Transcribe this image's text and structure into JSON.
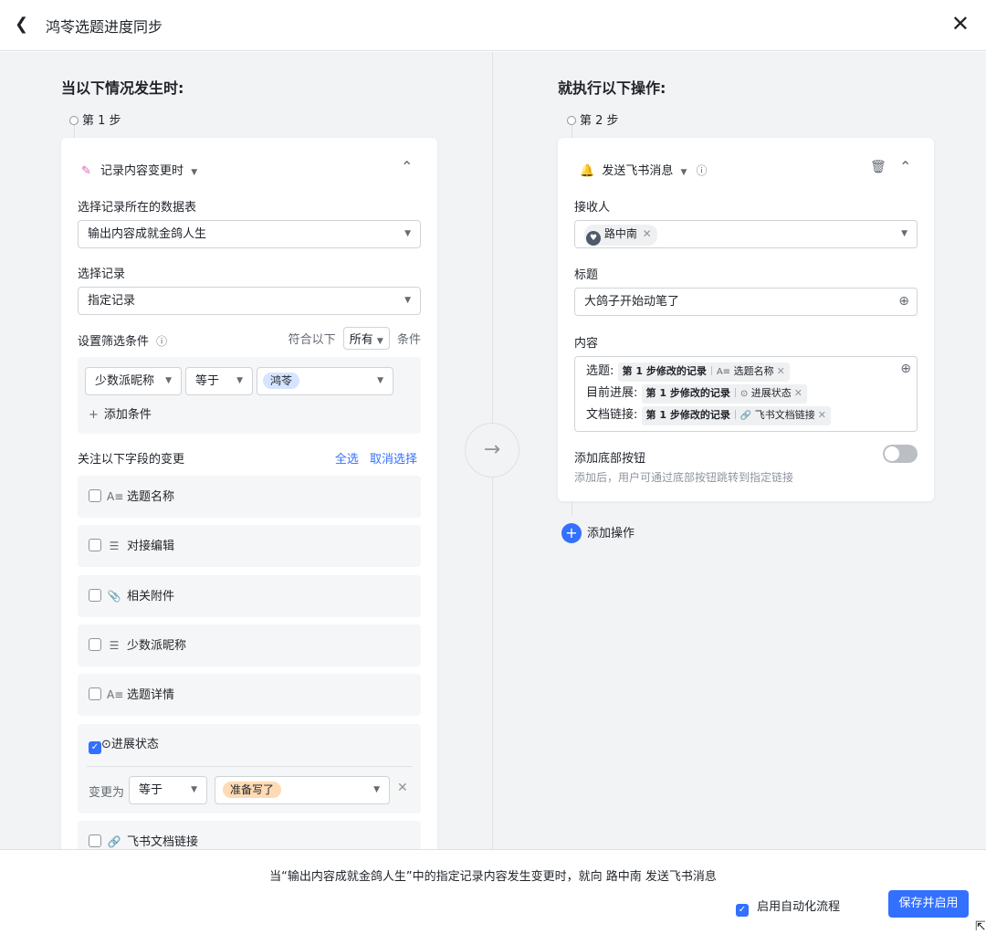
{
  "header": {
    "title": "鸿苓选题进度同步"
  },
  "left": {
    "heading": "当以下情况发生时:",
    "step": "第 1 步",
    "trigger": "记录内容变更时",
    "table_label": "选择记录所在的数据表",
    "table_value": "输出内容成就金鸽人生",
    "record_label": "选择记录",
    "record_value": "指定记录",
    "filter_label": "设置筛选条件",
    "match_prefix": "符合以下",
    "match_value": "所有",
    "match_suffix": "条件",
    "cond_field": "少数派昵称",
    "cond_op": "等于",
    "cond_value": "鸿苓",
    "add_cond": "添加条件",
    "watch_label": "关注以下字段的变更",
    "select_all": "全选",
    "deselect": "取消选择",
    "fields": [
      {
        "label": "选题名称",
        "icon": "text-field-icon",
        "checked": false
      },
      {
        "label": "对接编辑",
        "icon": "list-field-icon",
        "checked": false
      },
      {
        "label": "相关附件",
        "icon": "attachment-icon",
        "checked": false
      },
      {
        "label": "少数派昵称",
        "icon": "list-field-icon",
        "checked": false
      },
      {
        "label": "选题详情",
        "icon": "text-field-icon",
        "checked": false
      },
      {
        "label": "进展状态",
        "icon": "single-select-icon",
        "checked": true
      },
      {
        "label": "飞书文档链接",
        "icon": "link-icon",
        "checked": false
      }
    ],
    "change_to": "变更为",
    "change_op": "等于",
    "change_value": "准备写了"
  },
  "right": {
    "heading": "就执行以下操作:",
    "step": "第 2 步",
    "action": "发送飞书消息",
    "receiver_label": "接收人",
    "receiver": "路中南",
    "title_label": "标题",
    "title_value": "大鸽子开始动笔了",
    "content_label": "内容",
    "content_rows": [
      {
        "prefix": "选题:",
        "source": "第 1 步修改的记录",
        "field": "选题名称"
      },
      {
        "prefix": "目前进展:",
        "source": "第 1 步修改的记录",
        "field": "进展状态"
      },
      {
        "prefix": "文档链接:",
        "source": "第 1 步修改的记录",
        "field": "飞书文档链接"
      }
    ],
    "button_label": "添加底部按钮",
    "button_hint": "添加后，用户可通过底部按钮跳转到指定链接",
    "add_action": "添加操作"
  },
  "footer": {
    "summary": "当“输出内容成就金鸽人生”中的指定记录内容发生变更时，就向 路中南 发送飞书消息",
    "enable_label": "启用自动化流程",
    "save": "保存并启用"
  },
  "colors": {
    "accent": "#3370ff",
    "tag_blue": "#d6e4ff",
    "tag_orange": "#fedbb4"
  }
}
